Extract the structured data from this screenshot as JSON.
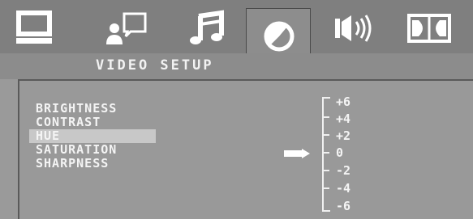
{
  "icons": [
    {
      "name": "monitor-icon"
    },
    {
      "name": "person-speech-icon"
    },
    {
      "name": "music-note-icon"
    },
    {
      "name": "video-dial-icon",
      "active": true
    },
    {
      "name": "speaker-icon"
    },
    {
      "name": "dolby-icon"
    }
  ],
  "header": {
    "title": "VIDEO SETUP"
  },
  "menu": {
    "items": [
      {
        "label": "BRIGHTNESS"
      },
      {
        "label": "CONTRAST"
      },
      {
        "label": "HUE",
        "selected": true
      },
      {
        "label": "SATURATION"
      },
      {
        "label": "SHARPNESS"
      }
    ]
  },
  "scale": {
    "values": [
      "+6",
      "+4",
      "+2",
      "0",
      "-2",
      "-4",
      "-6"
    ],
    "current": "0"
  },
  "colors": {
    "background": "#9a9a9a",
    "text": "#f4f4f4",
    "selection": "#c8c8c8"
  }
}
